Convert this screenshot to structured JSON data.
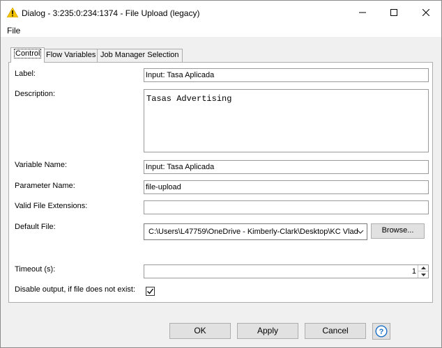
{
  "window": {
    "title": "Dialog - 3:235:0:234:1374 - File Upload (legacy)"
  },
  "menu": {
    "file": "File"
  },
  "tabs": [
    {
      "label": "Control",
      "active": true
    },
    {
      "label": "Flow Variables",
      "active": false
    },
    {
      "label": "Job Manager Selection",
      "active": false
    }
  ],
  "form": {
    "label": {
      "label": "Label:",
      "value": "Input: Tasa Aplicada"
    },
    "description": {
      "label": "Description:",
      "value": "Tasas Advertising"
    },
    "variable_name": {
      "label": "Variable Name:",
      "value": "Input: Tasa Aplicada"
    },
    "parameter_name": {
      "label": "Parameter Name:",
      "value": "file-upload"
    },
    "valid_extensions": {
      "label": "Valid File Extensions:",
      "value": ""
    },
    "default_file": {
      "label": "Default File:",
      "value": "C:\\Users\\L47759\\OneDrive - Kimberly-Clark\\Desktop\\KC Vlad",
      "browse_label": "Browse..."
    },
    "timeout": {
      "label": "Timeout (s):",
      "value": "1"
    },
    "disable_output": {
      "label": "Disable output, if file does not exist:",
      "checked": true
    }
  },
  "buttons": {
    "ok": "OK",
    "apply": "Apply",
    "cancel": "Cancel"
  },
  "icons": {
    "title": "warning-icon",
    "help": "help-icon"
  },
  "colors": {
    "warning": "#f5c400",
    "help": "#1a6fc9"
  }
}
